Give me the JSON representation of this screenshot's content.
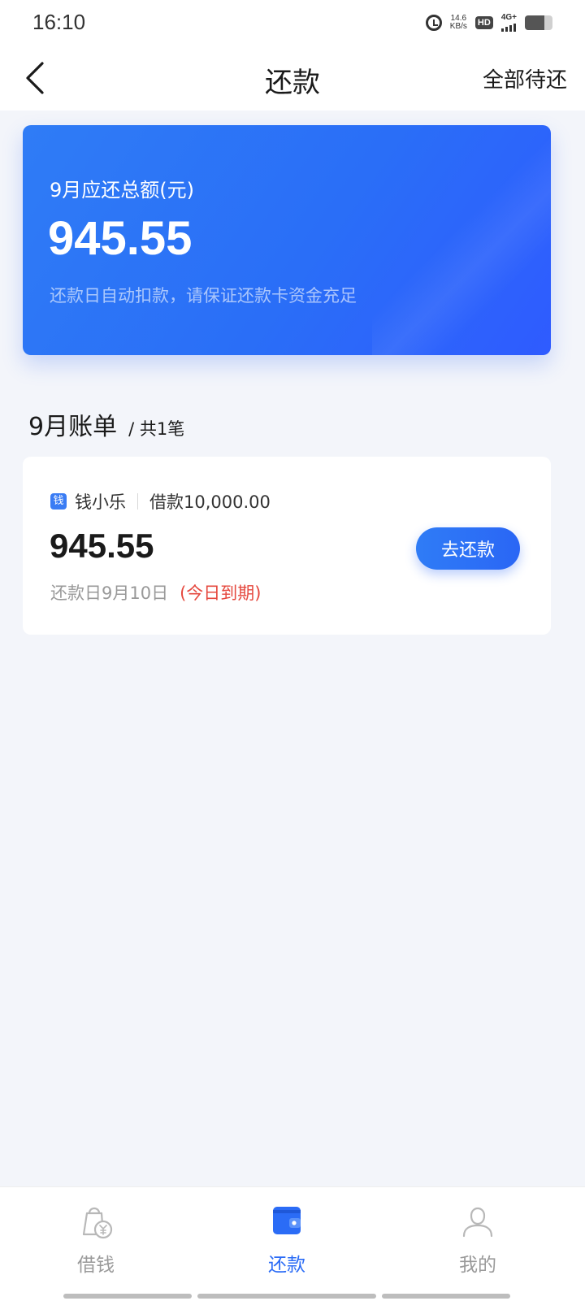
{
  "status_bar": {
    "time": "16:10",
    "net_speed_value": "14.6",
    "net_speed_unit": "KB/s",
    "hd_label": "HD",
    "signal_label": "4G+",
    "battery_level": 0.7
  },
  "header": {
    "title": "还款",
    "action_label": "全部待还"
  },
  "summary": {
    "label": "9月应还总额(元)",
    "amount": "945.55",
    "note": "还款日自动扣款，请保证还款卡资金充足"
  },
  "section": {
    "month_title": "9月账单",
    "count": "/ 共1笔"
  },
  "bills": [
    {
      "lender_icon_char": "钱",
      "lender_name": "钱小乐",
      "loan_amount": "借款10,000.00",
      "amount": "945.55",
      "due_date": "还款日9月10日",
      "due_status": "(今日到期)",
      "button_label": "去还款"
    }
  ],
  "tabs": [
    {
      "label": "借钱",
      "icon": "loan-bag-icon",
      "active": false
    },
    {
      "label": "还款",
      "icon": "wallet-icon",
      "active": true
    },
    {
      "label": "我的",
      "icon": "user-icon",
      "active": false
    }
  ],
  "colors": {
    "accent": "#2b6cf6",
    "due_warning": "#e5483e",
    "page_background": "#f3f5fa"
  }
}
